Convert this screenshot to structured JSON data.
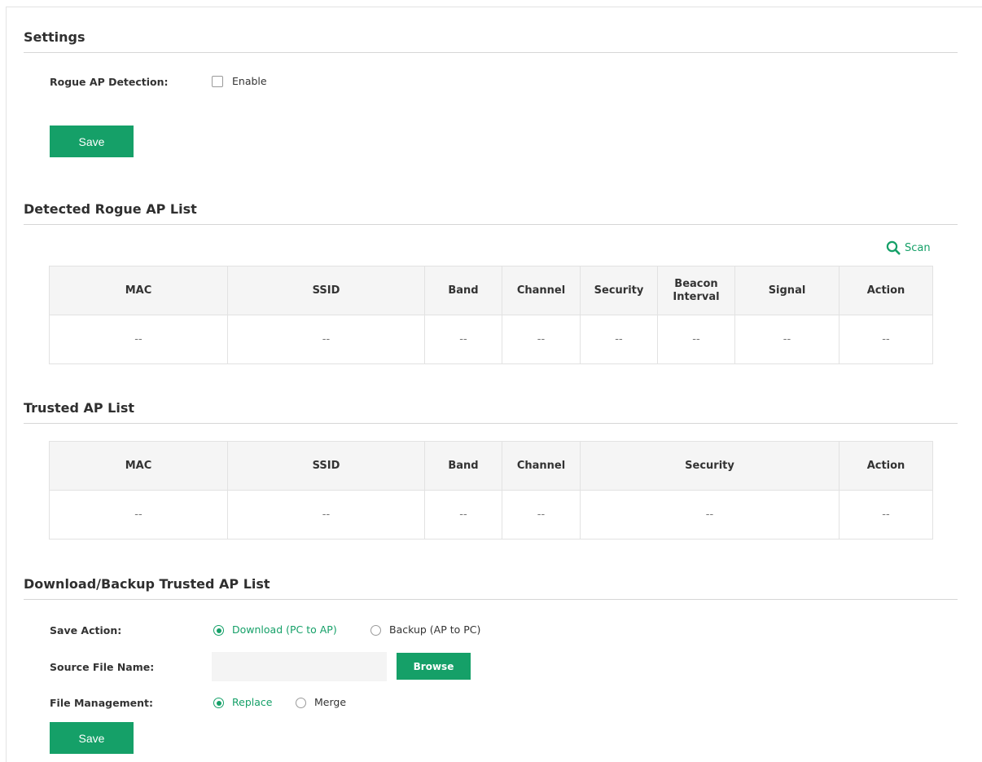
{
  "settings": {
    "title": "Settings",
    "rogue_label": "Rogue AP Detection:",
    "enable_label": "Enable",
    "save_label": "Save"
  },
  "detected": {
    "title": "Detected Rogue AP List",
    "scan_label": "Scan",
    "columns": [
      "MAC",
      "SSID",
      "Band",
      "Channel",
      "Security",
      "Beacon Interval",
      "Signal",
      "Action"
    ],
    "row": [
      "--",
      "--",
      "--",
      "--",
      "--",
      "--",
      "--",
      "--"
    ]
  },
  "trusted": {
    "title": "Trusted AP List",
    "columns": [
      "MAC",
      "SSID",
      "Band",
      "Channel",
      "Security",
      "Action"
    ],
    "row": [
      "--",
      "--",
      "--",
      "--",
      "--",
      "--"
    ]
  },
  "backup": {
    "title": "Download/Backup Trusted AP List",
    "save_action_label": "Save Action:",
    "download_option": "Download (PC to AP)",
    "backup_option": "Backup (AP to PC)",
    "source_label": "Source File Name:",
    "source_value": "",
    "browse_label": "Browse",
    "file_mgmt_label": "File Management:",
    "replace_option": "Replace",
    "merge_option": "Merge",
    "save_label": "Save"
  },
  "colors": {
    "accent": "#15a068",
    "header_bg": "#f5f5f5",
    "border": "#e2e2e2"
  }
}
